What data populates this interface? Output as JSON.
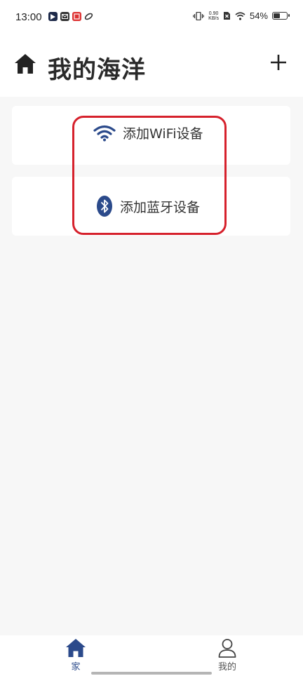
{
  "status_bar": {
    "time": "13:00",
    "net_speed_value": "0.90",
    "net_speed_unit": "KB/s",
    "battery": "54%"
  },
  "header": {
    "title": "我的海洋"
  },
  "menu": {
    "wifi_label": "添加WiFi设备",
    "bluetooth_label": "添加蓝牙设备"
  },
  "bottom_nav": {
    "home_label": "家",
    "mine_label": "我的"
  },
  "colors": {
    "accent": "#2b4a8b",
    "highlight": "#d6212c",
    "background": "#f7f7f7"
  }
}
